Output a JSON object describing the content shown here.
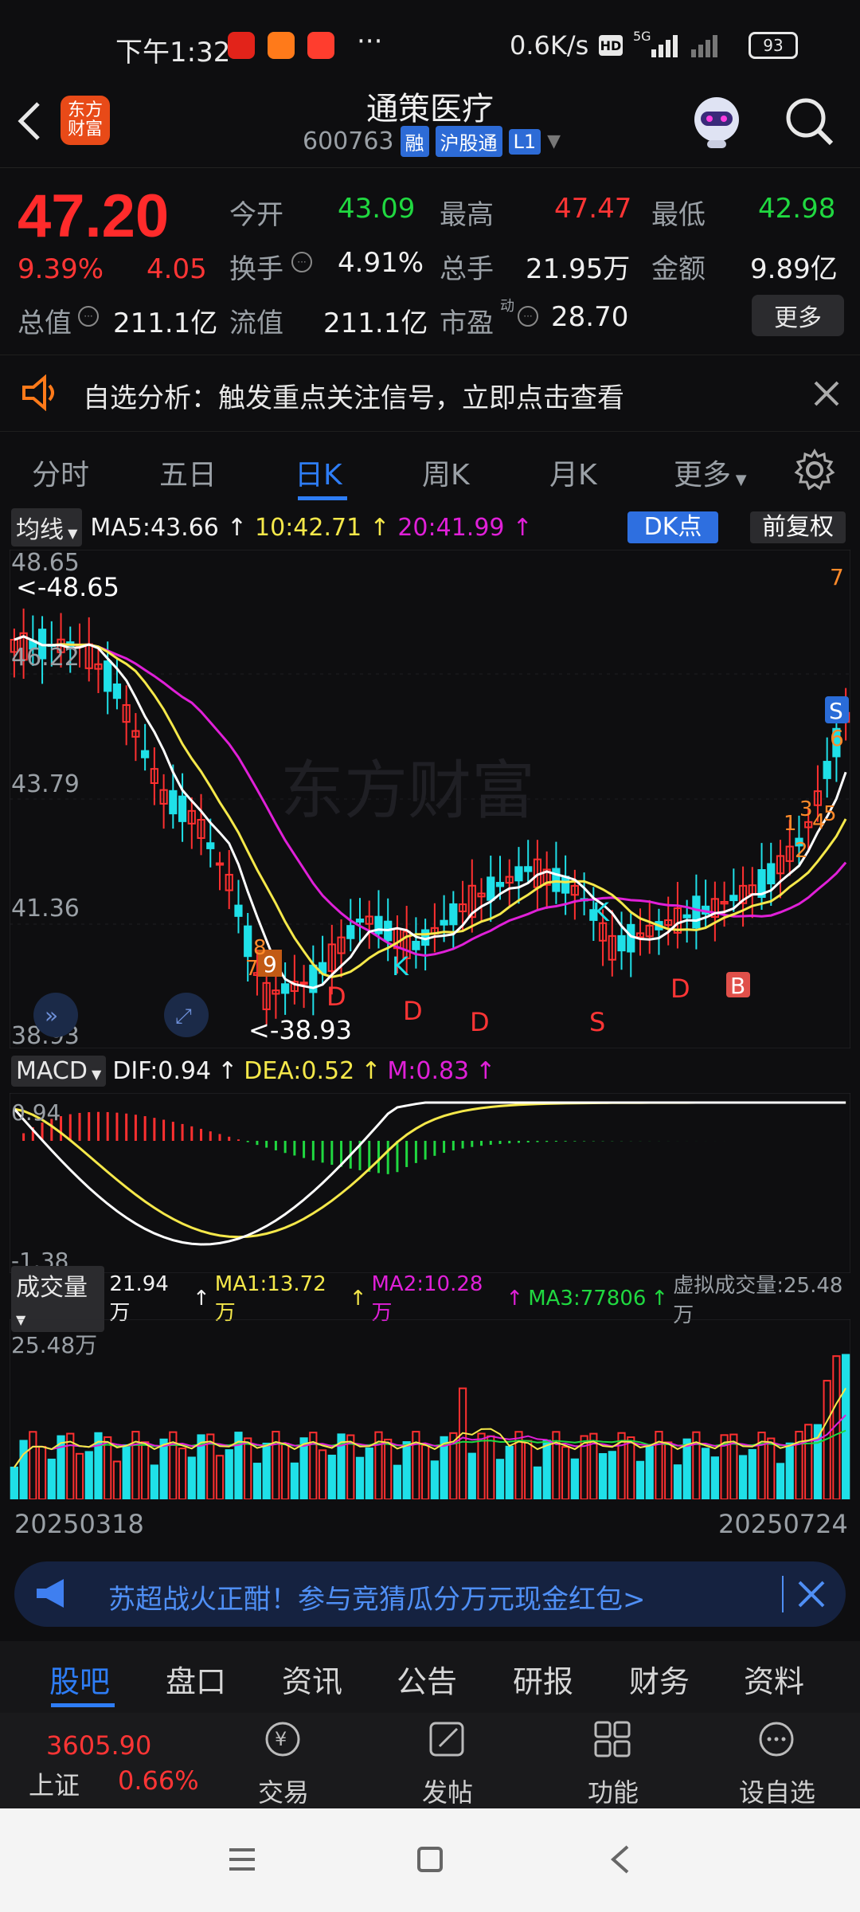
{
  "status_bar": {
    "time": "下午1:32",
    "net_speed": "0.6K/s",
    "network": "5G",
    "battery": "93",
    "more": "···"
  },
  "header": {
    "logo_text": "东方财富",
    "stock_name": "通策医疗",
    "stock_code": "600763",
    "tags": [
      "融",
      "沪股通",
      "L1"
    ]
  },
  "quote": {
    "price": "47.20",
    "change_pct": "9.39%",
    "change_amt": "4.05",
    "fields": [
      {
        "label": "今开",
        "value": "43.09"
      },
      {
        "label": "最高",
        "value": "47.47"
      },
      {
        "label": "最低",
        "value": "42.98"
      },
      {
        "label": "换手",
        "value": "4.91%"
      },
      {
        "label": "总手",
        "value": "21.95万"
      },
      {
        "label": "金额",
        "value": "9.89亿"
      },
      {
        "label": "总值",
        "value": "211.1亿"
      },
      {
        "label": "流值",
        "value": "211.1亿"
      },
      {
        "label": "市盈",
        "value": "28.70"
      }
    ],
    "pe_superscript": "动",
    "more_label": "更多"
  },
  "notice": {
    "text": "自选分析：触发重点关注信号，立即点击查看"
  },
  "tabs": [
    "分时",
    "五日",
    "日K",
    "周K",
    "月K",
    "更多"
  ],
  "active_tab": "日K",
  "kline": {
    "indicator_label": "均线",
    "ma5": "MA5:43.66",
    "ma10": "10:42.71",
    "ma20": "20:41.99",
    "dk_label": "DK点",
    "adjust_label": "前复权",
    "y_ticks": [
      "48.65",
      "46.22",
      "43.79",
      "41.36",
      "38.93"
    ],
    "high_marker": "<-48.65",
    "low_marker": "<-38.93",
    "watermark": "东方财富",
    "signals": [
      "D",
      "D",
      "K",
      "D",
      "K",
      "S",
      "D",
      "B",
      "S",
      "7",
      "6",
      "1",
      "2",
      "3",
      "4",
      "5",
      "9",
      "7",
      "8"
    ],
    "colors": {
      "up": "#ff3030",
      "down": "#1fe0e8",
      "ma5": "#ffffff",
      "ma10": "#f5e84a",
      "ma20": "#e020d8"
    }
  },
  "macd": {
    "label": "MACD",
    "dif": "DIF:0.94",
    "dea": "DEA:0.52",
    "m": "M:0.83",
    "y_ticks": [
      "0.94",
      "-1.38"
    ]
  },
  "volume": {
    "label": "成交量",
    "vol": "21.94万",
    "ma1": "MA1:13.72万",
    "ma2": "MA2:10.28万",
    "ma3": "MA3:77806",
    "virtual": "虚拟成交量:25.48万",
    "y_tick": "25.48万",
    "date_start": "20250318",
    "date_end": "20250724"
  },
  "banner": {
    "text": "苏超战火正酣！参与竞猜瓜分万元现金红包>"
  },
  "bottom_tabs": [
    "股吧",
    "盘口",
    "资讯",
    "公告",
    "研报",
    "财务",
    "资料"
  ],
  "active_bottom_tab": "股吧",
  "bottom_nav": {
    "index_value": "3605.90",
    "index_name": "上证",
    "index_change": "0.66%",
    "items": [
      "交易",
      "发帖",
      "功能",
      "设自选"
    ]
  }
}
